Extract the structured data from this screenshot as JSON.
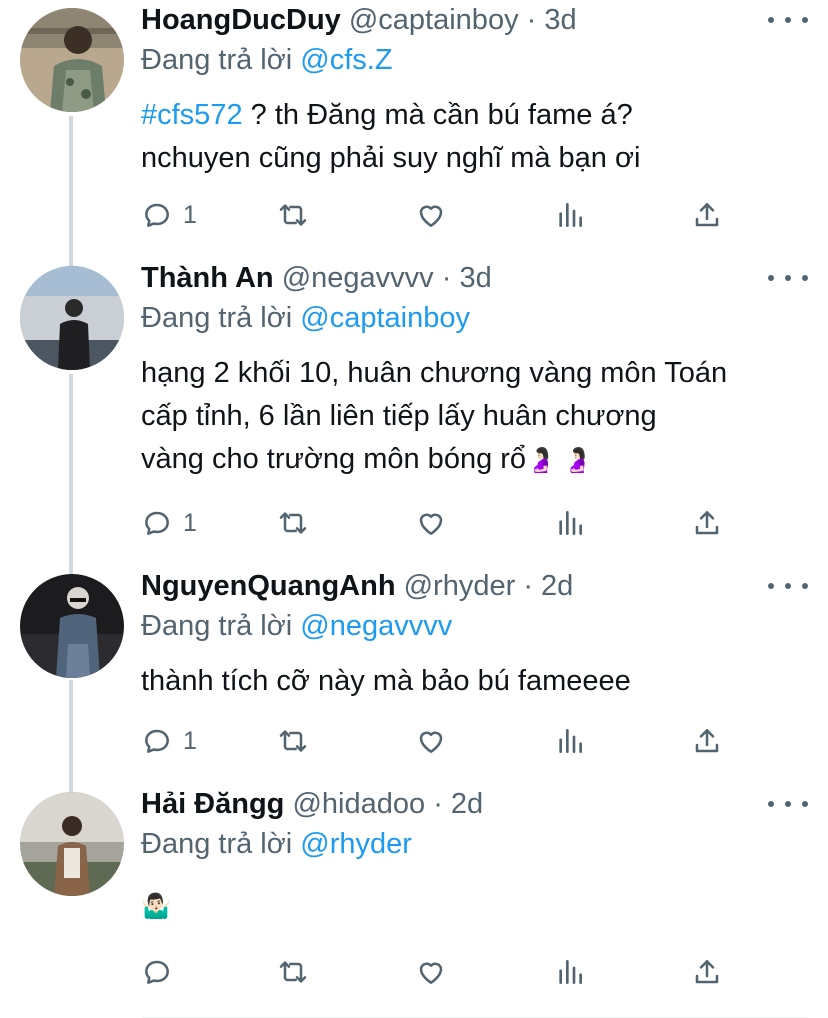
{
  "tweets": [
    {
      "name": "HoangDucDuy",
      "handle": "@captainboy",
      "sep": "·",
      "time": "3d",
      "reply_prefix": "Đang trả lời",
      "reply_to": "@cfs.Z",
      "hashtag": "#cfs572",
      "body_line1_rest": " ? th Đăng mà cần bú fame á?",
      "body_line2": "nchuyen cũng phải suy nghĩ mà bạn ơi",
      "reply_count": "1"
    },
    {
      "name": "Thành An",
      "handle": "@negavvvv",
      "sep": "·",
      "time": "3d",
      "reply_prefix": "Đang trả lời",
      "reply_to": "@captainboy",
      "body_line1": "hạng 2 khối 10, huân chương vàng môn Toán",
      "body_line2": "cấp tỉnh, 6 lần liên tiếp lấy huân chương",
      "body_line3": "vàng cho trường môn bóng rổ",
      "emojis": "🤰🏻 🤰🏻",
      "reply_count": "1"
    },
    {
      "name": "NguyenQuangAnh",
      "handle": "@rhyder",
      "sep": "·",
      "time": "2d",
      "reply_prefix": "Đang trả lời",
      "reply_to": "@negavvvv",
      "body_line1": "thành tích cỡ này mà bảo bú fameeee",
      "reply_count": "1"
    },
    {
      "name": "Hải Đăngg",
      "handle": "@hidadoo",
      "sep": "·",
      "time": "2d",
      "reply_prefix": "Đang trả lời",
      "reply_to": "@rhyder",
      "emoji": "🤷🏻‍♂️",
      "reply_count": ""
    }
  ],
  "icons": {
    "reply": "reply-icon",
    "retweet": "retweet-icon",
    "like": "like-icon",
    "views": "views-icon",
    "share": "share-icon",
    "more": "more-icon"
  },
  "colors": {
    "text": "#0f1419",
    "secondary": "#536471",
    "link": "#1d9bf0",
    "thread_line": "#cfd9de"
  }
}
